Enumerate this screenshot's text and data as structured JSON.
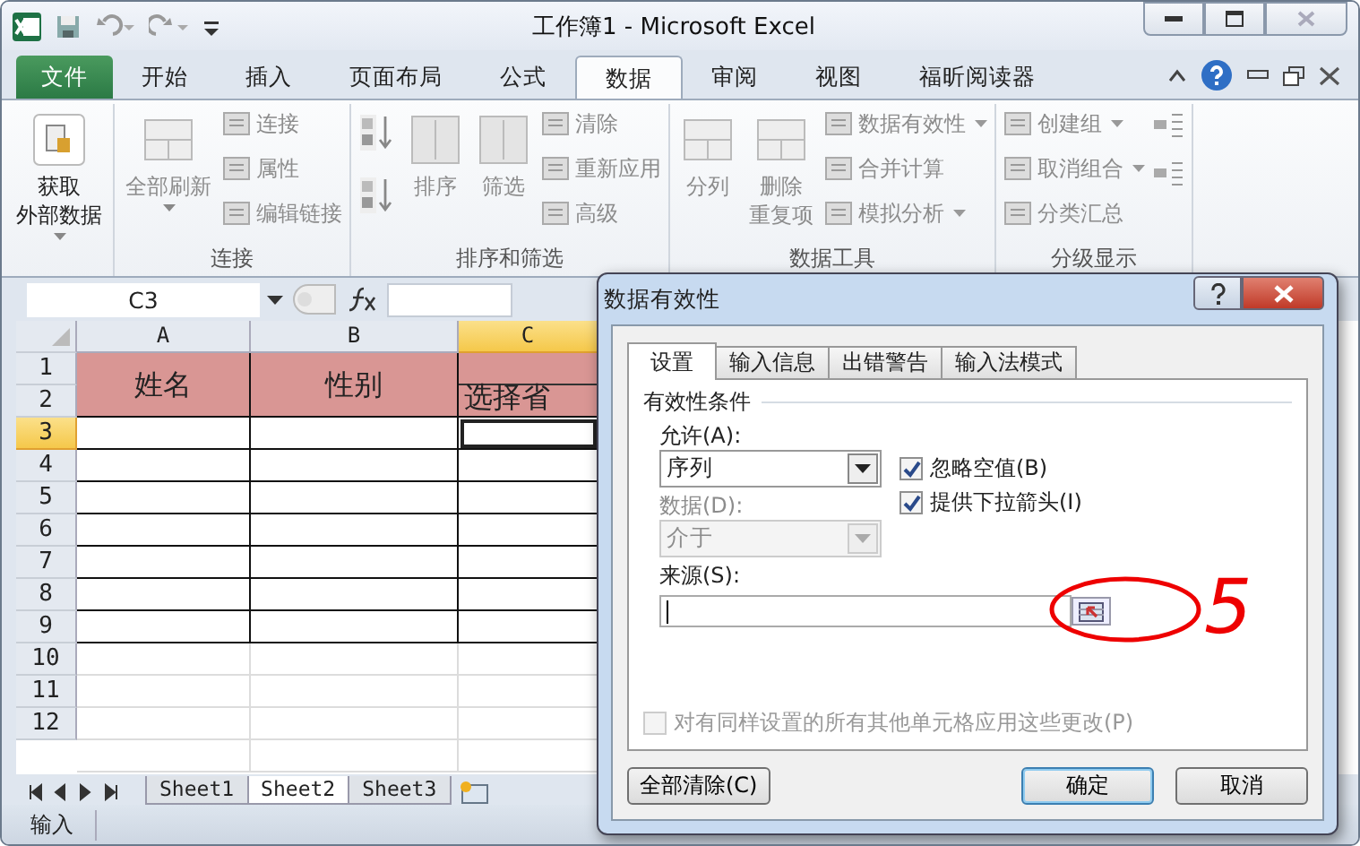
{
  "window": {
    "title": "工作簿1  -  Microsoft Excel"
  },
  "ribbon_tabs": [
    {
      "label": "文件",
      "kind": "file",
      "selected": false
    },
    {
      "label": "开始",
      "kind": "tab",
      "selected": false
    },
    {
      "label": "插入",
      "kind": "tab",
      "selected": false
    },
    {
      "label": "页面布局",
      "kind": "tab",
      "selected": false
    },
    {
      "label": "公式",
      "kind": "tab",
      "selected": false
    },
    {
      "label": "数据",
      "kind": "tab",
      "selected": true
    },
    {
      "label": "审阅",
      "kind": "tab",
      "selected": false
    },
    {
      "label": "视图",
      "kind": "tab",
      "selected": false
    },
    {
      "label": "福昕阅读器",
      "kind": "tab",
      "selected": false
    }
  ],
  "ribbon_groups": [
    {
      "columns": [
        [
          {
            "lines": [
              "获取",
              "外部数据"
            ],
            "kind": "large",
            "dropdown": true,
            "disabled": false
          }
        ]
      ]
    },
    {
      "label": "连接",
      "columns": [
        [
          {
            "lines": [
              "全部刷新"
            ],
            "kind": "large",
            "dropdown": true,
            "disabled": true
          }
        ],
        [
          {
            "label": "连接",
            "kind": "small",
            "dropdown": false,
            "disabled": true
          },
          {
            "label": "属性",
            "kind": "small",
            "dropdown": false,
            "disabled": true
          },
          {
            "label": "编辑链接",
            "kind": "small",
            "dropdown": false,
            "disabled": true
          }
        ]
      ]
    },
    {
      "label": "排序和筛选",
      "columns": [
        [
          {
            "kind": "sort-asc",
            "disabled": true
          },
          {
            "kind": "sort-desc",
            "disabled": true
          }
        ],
        [
          {
            "lines": [
              "排序"
            ],
            "kind": "large",
            "dropdown": false,
            "disabled": true
          }
        ],
        [
          {
            "lines": [
              "筛选"
            ],
            "kind": "large",
            "dropdown": false,
            "disabled": true
          }
        ],
        [
          {
            "label": "清除",
            "kind": "small",
            "dropdown": false,
            "disabled": true
          },
          {
            "label": "重新应用",
            "kind": "small",
            "dropdown": false,
            "disabled": true
          },
          {
            "label": "高级",
            "kind": "small",
            "dropdown": false,
            "disabled": true
          }
        ]
      ]
    },
    {
      "label": "数据工具",
      "columns": [
        [
          {
            "lines": [
              "分列"
            ],
            "kind": "large",
            "dropdown": false,
            "disabled": true
          }
        ],
        [
          {
            "lines": [
              "删除",
              "重复项"
            ],
            "kind": "large",
            "dropdown": false,
            "disabled": true
          }
        ],
        [
          {
            "label": "数据有效性",
            "kind": "small",
            "dropdown": true,
            "disabled": true
          },
          {
            "label": "合并计算",
            "kind": "small",
            "dropdown": false,
            "disabled": true
          },
          {
            "label": "模拟分析",
            "kind": "small",
            "dropdown": true,
            "disabled": true
          }
        ]
      ]
    },
    {
      "label": "分级显示",
      "columns": [
        [
          {
            "label": "创建组",
            "kind": "small",
            "dropdown": true,
            "disabled": true
          },
          {
            "label": "取消组合",
            "kind": "small",
            "dropdown": true,
            "disabled": true
          },
          {
            "label": "分类汇总",
            "kind": "small",
            "dropdown": false,
            "disabled": true
          }
        ],
        [
          {
            "kind": "icon",
            "disabled": true
          },
          {
            "kind": "icon",
            "disabled": true
          }
        ]
      ]
    }
  ],
  "name_box": "C3",
  "sheet": {
    "columns": [
      {
        "label": "A",
        "selected": false
      },
      {
        "label": "B",
        "selected": false
      },
      {
        "label": "C",
        "selected": true
      }
    ],
    "headers": [
      "姓名",
      "性别",
      "选择省"
    ],
    "rows": [
      {
        "label": "1",
        "selected": false
      },
      {
        "label": "2",
        "selected": false
      },
      {
        "label": "3",
        "selected": true
      },
      {
        "label": "4",
        "selected": false
      },
      {
        "label": "5",
        "selected": false
      },
      {
        "label": "6",
        "selected": false
      },
      {
        "label": "7",
        "selected": false
      },
      {
        "label": "8",
        "selected": false
      },
      {
        "label": "9",
        "selected": false
      },
      {
        "label": "10",
        "selected": false
      },
      {
        "label": "11",
        "selected": false
      },
      {
        "label": "12",
        "selected": false
      }
    ]
  },
  "sheet_tabs": [
    {
      "label": "Sheet1",
      "selected": false
    },
    {
      "label": "Sheet2",
      "selected": true
    },
    {
      "label": "Sheet3",
      "selected": false
    }
  ],
  "status_bar": "输入",
  "dialog": {
    "title": "数据有效性",
    "tabs": [
      {
        "label": "设置",
        "selected": true
      },
      {
        "label": "输入信息",
        "selected": false
      },
      {
        "label": "出错警告",
        "selected": false
      },
      {
        "label": "输入法模式",
        "selected": false
      }
    ],
    "section": "有效性条件",
    "allow": {
      "label": "允许(A):",
      "value": "序列",
      "disabled": false
    },
    "data": {
      "label": "数据(D):",
      "value": "介于",
      "disabled": true
    },
    "checkboxes": [
      {
        "label": "忽略空值(B)",
        "checked": true,
        "disabled": false
      },
      {
        "label": "提供下拉箭头(I)",
        "checked": true,
        "disabled": false
      }
    ],
    "source": {
      "label": "来源(S):"
    },
    "apply_all": {
      "label": "对有同样设置的所有其他单元格应用这些更改(P)",
      "checked": false,
      "disabled": true
    },
    "buttons": [
      {
        "label": "全部清除(C)",
        "kind": "left",
        "selected": false
      },
      {
        "label": "确定",
        "kind": "right",
        "selected": true
      },
      {
        "label": "取消",
        "kind": "right",
        "selected": false
      }
    ]
  },
  "annotation": {
    "label": "5"
  }
}
